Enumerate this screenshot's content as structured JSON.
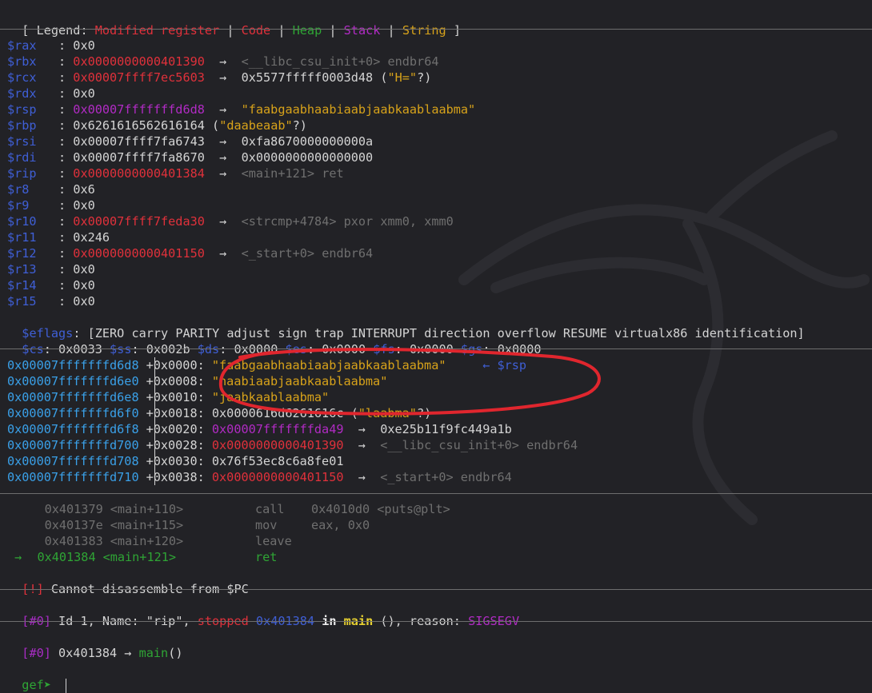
{
  "legend": {
    "prefix": "[ Legend: ",
    "modified": "Modified register",
    "sep": " | ",
    "code": "Code",
    "heap": "Heap",
    "stack": "Stack",
    "string": "String",
    "suffix": " ]"
  },
  "registers": [
    {
      "name": "$rax",
      "sep": "   : ",
      "value": "0x0",
      "arrow": "",
      "target": "",
      "color": "plain",
      "target_color": "plain"
    },
    {
      "name": "$rbx",
      "sep": "   : ",
      "value": "0x0000000000401390",
      "arrow": "  →  ",
      "target": "<__libc_csu_init+0> endbr64",
      "color": "red",
      "target_color": "dim"
    },
    {
      "name": "$rcx",
      "sep": "   : ",
      "value": "0x00007ffff7ec5603",
      "arrow": "  →  ",
      "target": "0x5577fffff0003d48 (\"H=\"?)",
      "color": "red",
      "target_color": "mixed_rcx"
    },
    {
      "name": "$rdx",
      "sep": "   : ",
      "value": "0x0",
      "arrow": "",
      "target": "",
      "color": "plain",
      "target_color": "plain"
    },
    {
      "name": "$rsp",
      "sep": "   : ",
      "value": "0x00007fffffffd6d8",
      "arrow": "  →  ",
      "target": "\"faabgaabhaabiaabjaabkaablaabma\"",
      "color": "purple",
      "target_color": "yellow"
    },
    {
      "name": "$rbp",
      "sep": "   : ",
      "value": "0x6261616562616164",
      "arrow": "",
      "target": " (\"daabeaab\"?)",
      "color": "plain",
      "target_color": "mixed_rbp"
    },
    {
      "name": "$rsi",
      "sep": "   : ",
      "value": "0x00007ffff7fa6743",
      "arrow": "  →  ",
      "target": "0xfa8670000000000a",
      "color": "plain",
      "target_color": "plain"
    },
    {
      "name": "$rdi",
      "sep": "   : ",
      "value": "0x00007ffff7fa8670",
      "arrow": "  →  ",
      "target": "0x0000000000000000",
      "color": "plain",
      "target_color": "plain"
    },
    {
      "name": "$rip",
      "sep": "   : ",
      "value": "0x0000000000401384",
      "arrow": "  →  ",
      "target": "<main+121> ret",
      "color": "red",
      "target_color": "dim"
    },
    {
      "name": "$r8",
      "sep": "    : ",
      "value": "0x6",
      "arrow": "",
      "target": "",
      "color": "plain",
      "target_color": "plain"
    },
    {
      "name": "$r9",
      "sep": "    : ",
      "value": "0x0",
      "arrow": "",
      "target": "",
      "color": "plain",
      "target_color": "plain"
    },
    {
      "name": "$r10",
      "sep": "   : ",
      "value": "0x00007ffff7feda30",
      "arrow": "  →  ",
      "target": "<strcmp+4784> pxor xmm0, xmm0",
      "color": "red",
      "target_color": "dim"
    },
    {
      "name": "$r11",
      "sep": "   : ",
      "value": "0x246",
      "arrow": "",
      "target": "",
      "color": "plain",
      "target_color": "plain"
    },
    {
      "name": "$r12",
      "sep": "   : ",
      "value": "0x0000000000401150",
      "arrow": "  →  ",
      "target": "<_start+0> endbr64",
      "color": "red",
      "target_color": "dim"
    },
    {
      "name": "$r13",
      "sep": "   : ",
      "value": "0x0",
      "arrow": "",
      "target": "",
      "color": "plain",
      "target_color": "plain"
    },
    {
      "name": "$r14",
      "sep": "   : ",
      "value": "0x0",
      "arrow": "",
      "target": "",
      "color": "plain",
      "target_color": "plain"
    },
    {
      "name": "$r15",
      "sep": "   : ",
      "value": "0x0",
      "arrow": "",
      "target": "",
      "color": "plain",
      "target_color": "plain"
    }
  ],
  "eflags": {
    "name": "$eflags",
    "value": ": [ZERO carry PARITY adjust sign trap INTERRUPT direction overflow RESUME virtualx86 identification]"
  },
  "segments": [
    {
      "name": "$cs",
      "value": ": 0x0033 "
    },
    {
      "name": "$ss",
      "value": ": 0x002b "
    },
    {
      "name": "$ds",
      "value": ": 0x0000 "
    },
    {
      "name": "$es",
      "value": ": 0x0000 "
    },
    {
      "name": "$fs",
      "value": ": 0x0000 "
    },
    {
      "name": "$gs",
      "value": ": 0x0000"
    }
  ],
  "stack": [
    {
      "addr": "0x00007fffffffd6d8",
      "offset": "+0x0000: ",
      "value": "\"faabgaabhaabiaabjaabkaablaabma\"",
      "value_color": "yellow",
      "arrow": "",
      "target": "",
      "note": "     ← $rsp"
    },
    {
      "addr": "0x00007fffffffd6e0",
      "offset": "+0x0008: ",
      "value": "\"haabiaabjaabkaablaabma\"",
      "value_color": "yellow",
      "arrow": "",
      "target": "",
      "note": ""
    },
    {
      "addr": "0x00007fffffffd6e8",
      "offset": "+0x0010: ",
      "value": "\"jaabkaablaabma\"",
      "value_color": "yellow",
      "arrow": "",
      "target": "",
      "note": ""
    },
    {
      "addr": "0x00007fffffffd6f0",
      "offset": "+0x0018: ",
      "value": "0x0000616d6261616c",
      "value_color": "plain",
      "arrow": "",
      "target": " (\"laabma\"?)",
      "note": ""
    },
    {
      "addr": "0x00007fffffffd6f8",
      "offset": "+0x0020: ",
      "value": "0x00007fffffffda49",
      "value_color": "purple",
      "arrow": "  →  ",
      "target": "0xe25b11f9fc449a1b",
      "target_color": "plain",
      "note": ""
    },
    {
      "addr": "0x00007fffffffd700",
      "offset": "+0x0028: ",
      "value": "0x0000000000401390",
      "value_color": "red",
      "arrow": "  →  ",
      "target": "<__libc_csu_init+0> endbr64",
      "target_color": "dim",
      "note": ""
    },
    {
      "addr": "0x00007fffffffd708",
      "offset": "+0x0030: ",
      "value": "0x76f53ec8c6a8fe01",
      "value_color": "plain",
      "arrow": "",
      "target": "",
      "note": ""
    },
    {
      "addr": "0x00007fffffffd710",
      "offset": "+0x0038: ",
      "value": "0x0000000000401150",
      "value_color": "red",
      "arrow": "  →  ",
      "target": "<_start+0> endbr64",
      "target_color": "dim",
      "note": ""
    }
  ],
  "disasm": [
    {
      "marker": "    ",
      "addr": "0x401379",
      "sym": "<main+110>",
      "mnem": "call",
      "ops": "0x4010d0 <puts@plt>",
      "current": false
    },
    {
      "marker": "    ",
      "addr": "0x40137e",
      "sym": "<main+115>",
      "mnem": "mov",
      "ops": "eax, 0x0",
      "current": false
    },
    {
      "marker": "    ",
      "addr": "0x401383",
      "sym": "<main+120>",
      "mnem": "leave",
      "ops": "",
      "current": false
    },
    {
      "marker": " → ",
      "addr": "0x401384",
      "sym": "<main+121>",
      "mnem": "ret",
      "ops": "",
      "current": true
    }
  ],
  "disasm_error": {
    "tag": "[!]",
    "text": " Cannot disassemble from $PC"
  },
  "thread": {
    "tag": "[#0]",
    "text1": " Id 1, Name: \"rip\", ",
    "stopped": "stopped",
    "addr": " 0x401384",
    "in": " in ",
    "func": "main",
    "text2": " (), reason: ",
    "reason": "SIGSEGV"
  },
  "trace": {
    "tag": "[#0]",
    "addr": " 0x401384 → ",
    "func": "main",
    "suffix": "()"
  },
  "prompt": {
    "label": "gef➤",
    "input": ""
  },
  "colors": {
    "background": "#222226",
    "register_name": "#3f5fd6",
    "modified": "#e0313b",
    "heap": "#2fa535",
    "stack": "#b12bc4",
    "string": "#d7a21a",
    "annotation": "#e0262e"
  }
}
